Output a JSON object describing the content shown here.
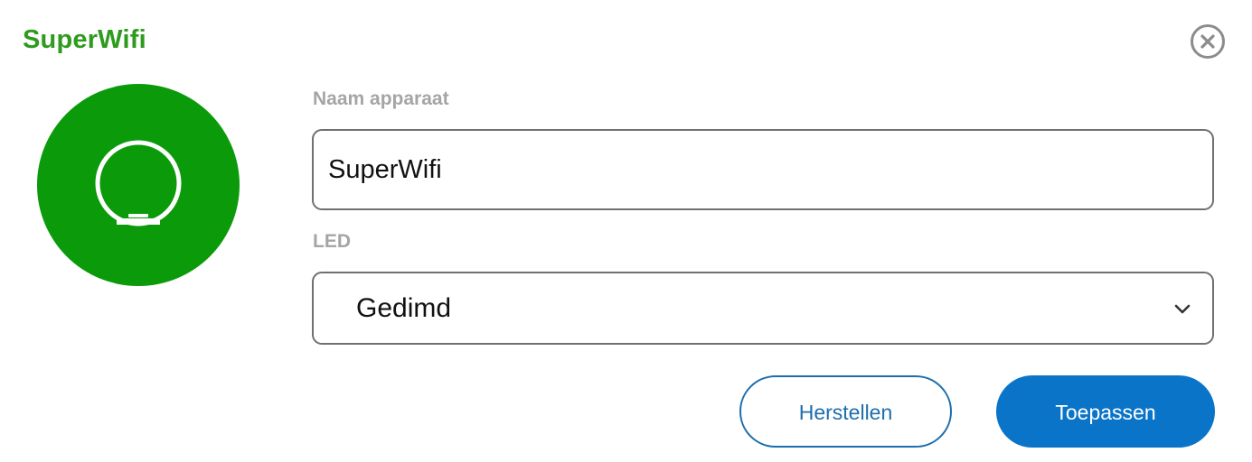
{
  "dialog": {
    "title": "SuperWifi",
    "close_icon": "close-circle-icon",
    "device_icon": "wifi-point-device-icon",
    "accent_color": "#2e9b1e",
    "device_circle_color": "#0a9a0a"
  },
  "form": {
    "name_label": "Naam apparaat",
    "name_value": "SuperWifi",
    "led_label": "LED",
    "led_selected": "Gedimd",
    "led_chevron_icon": "chevron-down-icon"
  },
  "actions": {
    "reset_label": "Herstellen",
    "apply_label": "Toepassen",
    "primary_color": "#0a74c8"
  }
}
